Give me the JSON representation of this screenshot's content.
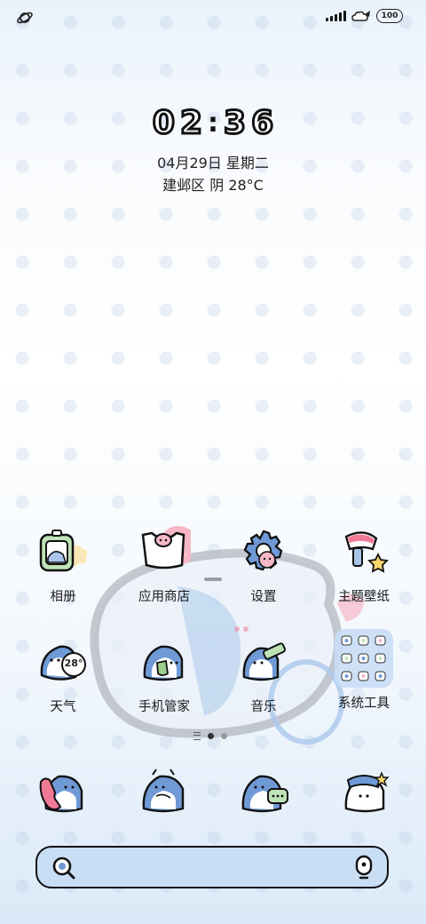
{
  "status_bar": {
    "left_icon": "orbit-icon",
    "battery_level": "100",
    "icons": [
      "signal-icon",
      "notification-cloud-icon",
      "battery-icon"
    ]
  },
  "lockscreen": {
    "time_digits": [
      "0",
      "2",
      "3",
      "6"
    ],
    "date": "04月29日 星期二",
    "weather": "建邺区 阴 28°C"
  },
  "apps": [
    {
      "label": "相册",
      "icon": "gallery-icon"
    },
    {
      "label": "应用商店",
      "icon": "app-store-icon"
    },
    {
      "label": "设置",
      "icon": "settings-gear-icon"
    },
    {
      "label": "主题壁纸",
      "icon": "theme-brush-icon"
    },
    {
      "label": "天气",
      "icon": "weather-icon",
      "badge": "28°"
    },
    {
      "label": "手机管家",
      "icon": "phone-manager-icon"
    },
    {
      "label": "音乐",
      "icon": "music-icon"
    },
    {
      "label": "系统工具",
      "icon": "system-tools-folder-icon"
    }
  ],
  "pager": {
    "pages": 2,
    "active": 0
  },
  "dock": [
    {
      "icon": "phone-icon"
    },
    {
      "icon": "contacts-icon"
    },
    {
      "icon": "messages-icon"
    },
    {
      "icon": "camera-icon"
    }
  ],
  "search": {
    "left_icon": "search-icon",
    "right_icon": "microphone-icon"
  },
  "colors": {
    "accent_blue": "#a9c6ea",
    "search_bg": "#c9ddf5",
    "pink": "#f6b7c6",
    "outline": "#111111"
  }
}
